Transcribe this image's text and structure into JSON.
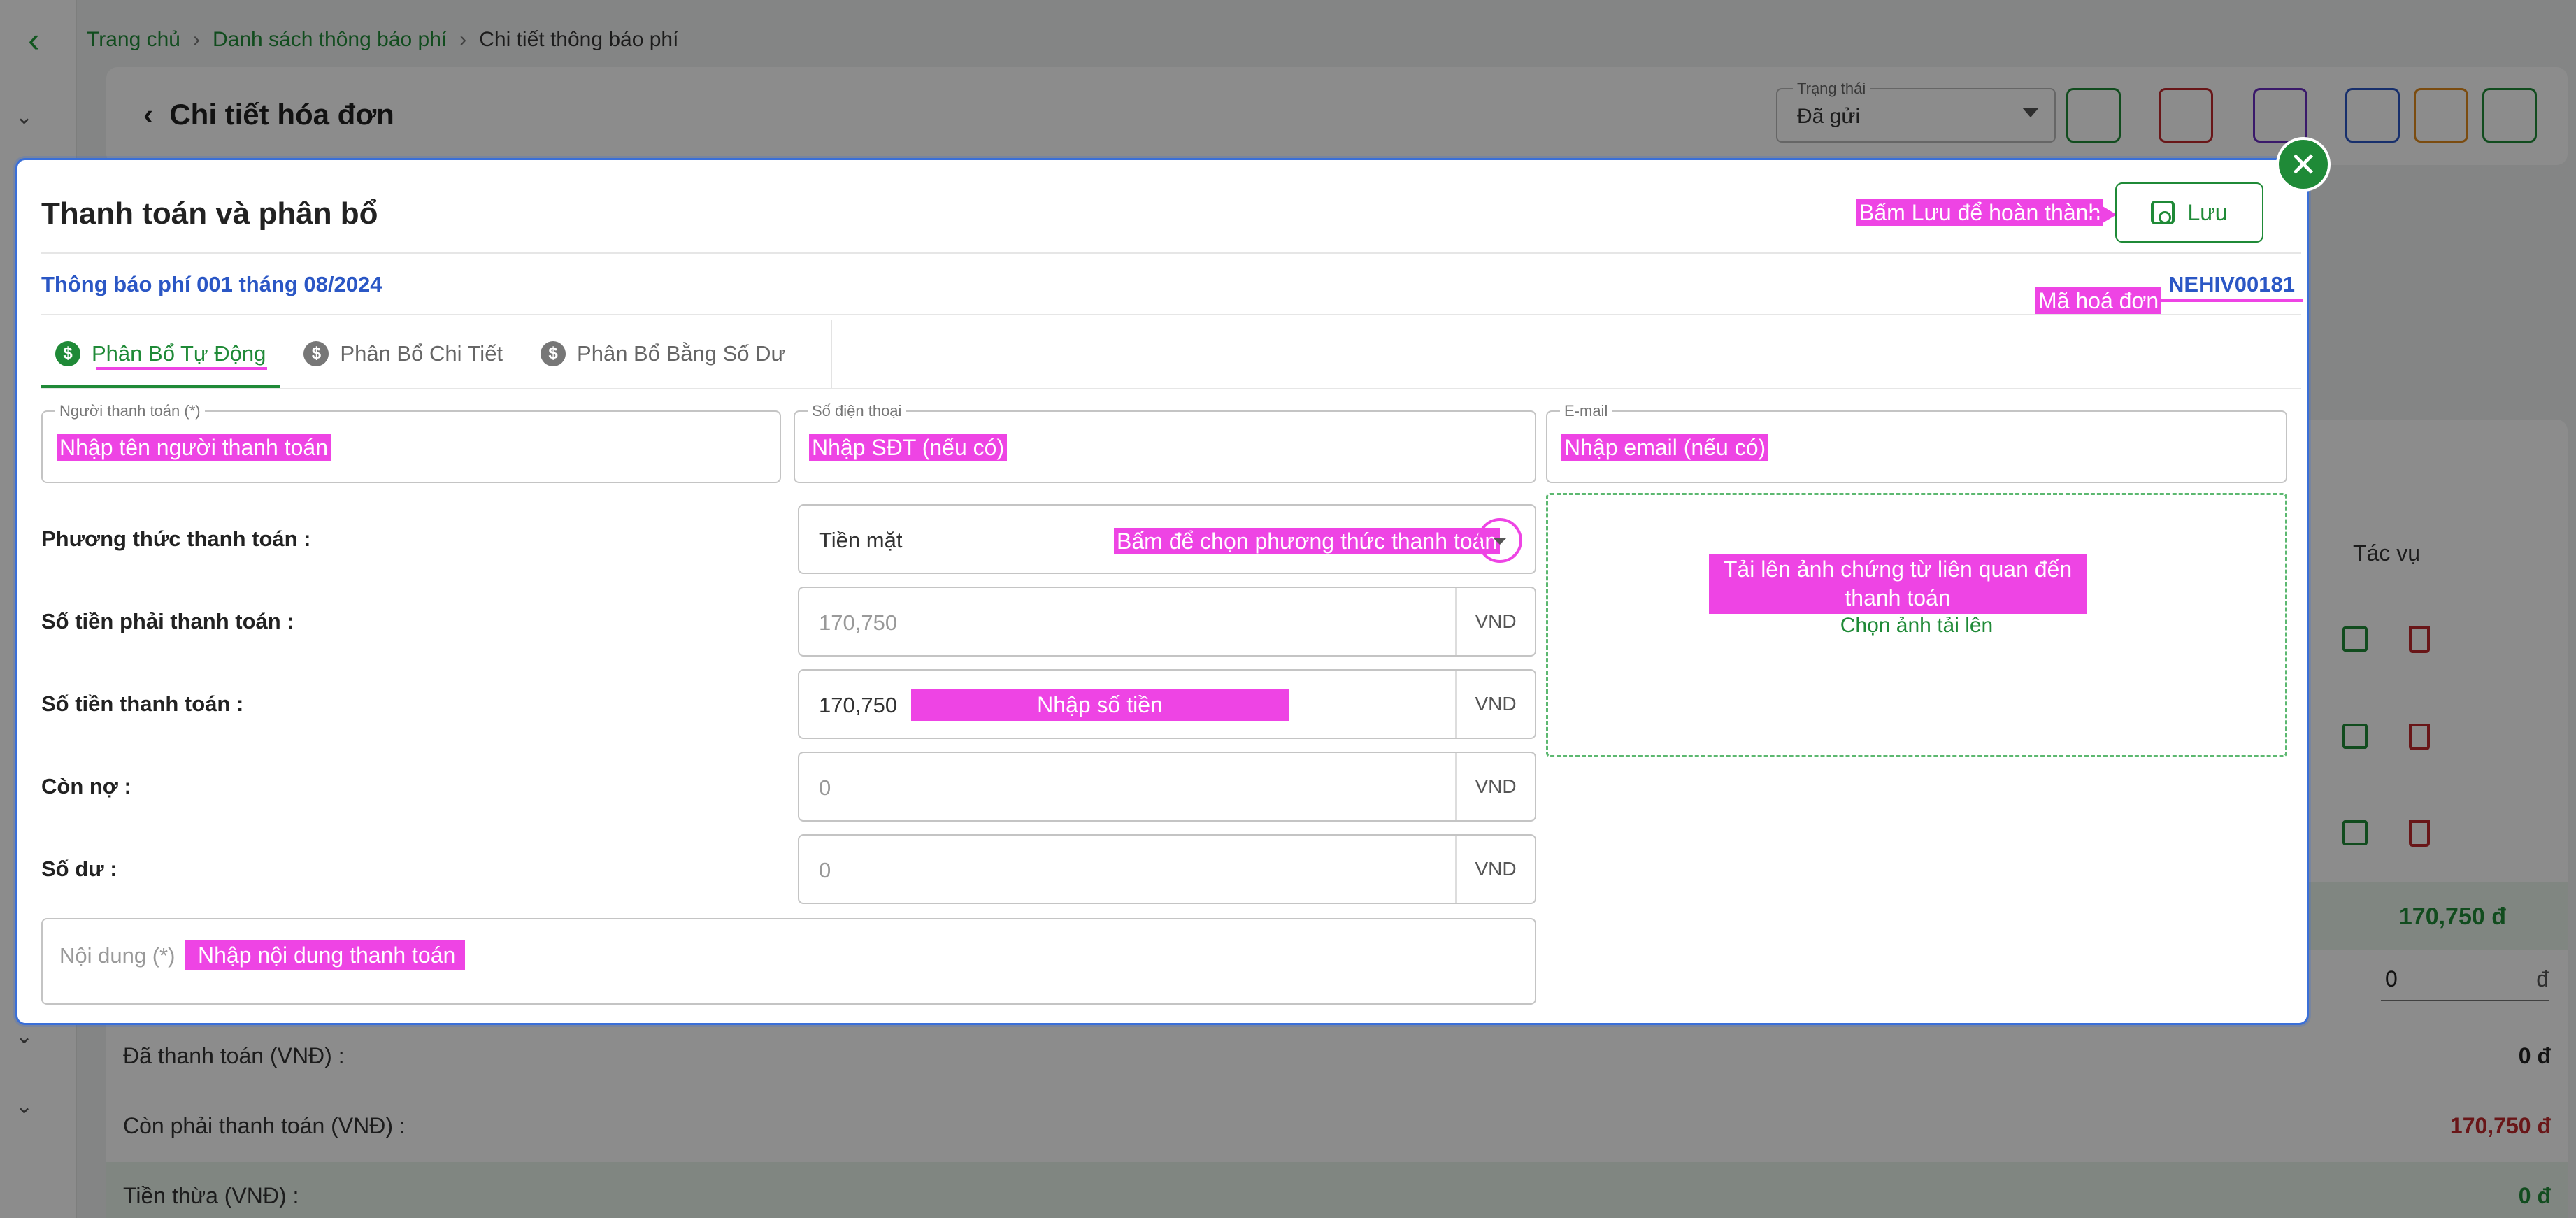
{
  "background": {
    "breadcrumb": [
      "Trang chủ",
      "Danh sách thông báo phí",
      "Chi tiết thông báo phí"
    ],
    "title": "Chi tiết hóa đơn",
    "status_label": "Trạng thái",
    "status_value": "Đã gửi",
    "actions_header": "Tác vụ",
    "total_amount": "170,750 đ",
    "zero_input": "0",
    "zero_unit": "đ",
    "rows": [
      {
        "label": "Đã thanh toán (VNĐ) :",
        "value": "0 đ",
        "color": "#222222"
      },
      {
        "label": "Còn phải thanh toán (VNĐ) :",
        "value": "170,750 đ",
        "color": "#c0282d"
      },
      {
        "label": "Tiền thừa (VNĐ) :",
        "value": "0 đ",
        "color": "#1f8a37"
      }
    ]
  },
  "modal": {
    "title": "Thanh toán và phân bổ",
    "save_label": "Lưu",
    "save_hint": "Bấm Lưu để hoàn thành",
    "notice_title": "Thông báo phí 001 tháng 08/2024",
    "invoice_code": "NEHIV00181",
    "invoice_code_hint": "Mã hoá đơn",
    "tabs": [
      {
        "label": "Phân Bổ Tự Động",
        "active": true
      },
      {
        "label": "Phân Bổ Chi Tiết",
        "active": false
      },
      {
        "label": "Phân Bổ Bằng Số Dư",
        "active": false
      }
    ],
    "payer": {
      "label": "Người thanh toán (*)",
      "hint": "Nhập tên người thanh toán"
    },
    "phone": {
      "label": "Số điện thoại",
      "hint": "Nhập SĐT (nếu có)"
    },
    "email": {
      "label": "E-mail",
      "hint": "Nhập email (nếu có)"
    },
    "payment_method": {
      "label": "Phương thức thanh toán :",
      "value": "Tiền mặt",
      "hint": "Bấm để chọn phương thức thanh toán"
    },
    "amount_due": {
      "label": "Số tiền phải thanh toán :",
      "value": "170,750",
      "unit": "VND"
    },
    "amount_paid": {
      "label": "Số tiền thanh toán :",
      "value": "170,750",
      "unit": "VND",
      "hint": "Nhập số tiền"
    },
    "debt": {
      "label": "Còn nợ :",
      "value": "0",
      "unit": "VND"
    },
    "balance": {
      "label": "Số dư :",
      "value": "0",
      "unit": "VND"
    },
    "upload": {
      "hint": "Tải lên ảnh chứng từ liên quan đến thanh toán",
      "pick": "Chọn ảnh tải lên"
    },
    "content": {
      "placeholder": "Nội dung (*)",
      "hint": "Nhập nội dung thanh toán"
    },
    "accent_color": "#1f8a37",
    "highlight_color": "#ee44e4"
  }
}
